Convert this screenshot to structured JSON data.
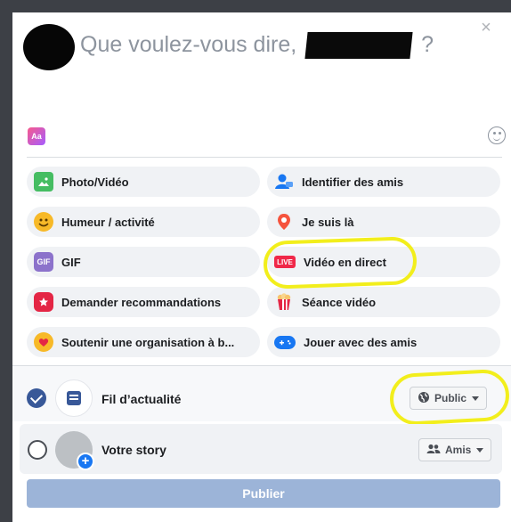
{
  "composer": {
    "prompt_prefix": "Que voulez-vous dire,",
    "prompt_suffix": "?",
    "close_glyph": "×",
    "aa_label": "Aa"
  },
  "actions": [
    {
      "label": "Photo/Vidéo",
      "icon": "photo-icon",
      "color": "#45bd62"
    },
    {
      "label": "Identifier des amis",
      "icon": "tag-friends-icon",
      "color": "#1877f2"
    },
    {
      "label": "Humeur / activité",
      "icon": "emoji-icon",
      "color": "#f7b928"
    },
    {
      "label": "Je suis là",
      "icon": "location-pin-icon",
      "color": "#f5533d"
    },
    {
      "label": "GIF",
      "icon": "gif-icon",
      "color": "#8c72cb"
    },
    {
      "label": "Vidéo en direct",
      "icon": "live-icon",
      "color": "#f02849"
    },
    {
      "label": "Demander recommandations",
      "icon": "recommendation-icon",
      "color": "#e42645"
    },
    {
      "label": "Séance vidéo",
      "icon": "popcorn-icon",
      "color": "#e42645"
    },
    {
      "label": "Soutenir une organisation à b...",
      "icon": "fundraiser-icon",
      "color": "#f7b928"
    },
    {
      "label": "Jouer avec des amis",
      "icon": "gamepad-icon",
      "color": "#1877f2"
    }
  ],
  "icon_text": {
    "gif": "GIF",
    "live": "LIVE"
  },
  "share": {
    "feed_label": "Fil d’actualité",
    "feed_privacy": "Public",
    "story_label": "Votre story",
    "story_privacy": "Amis",
    "story_plus": "+"
  },
  "publish_label": "Publier",
  "colors": {
    "accent": "#385898",
    "highlight": "#f2ee1c",
    "publish_disabled": "#9cb4d8"
  }
}
